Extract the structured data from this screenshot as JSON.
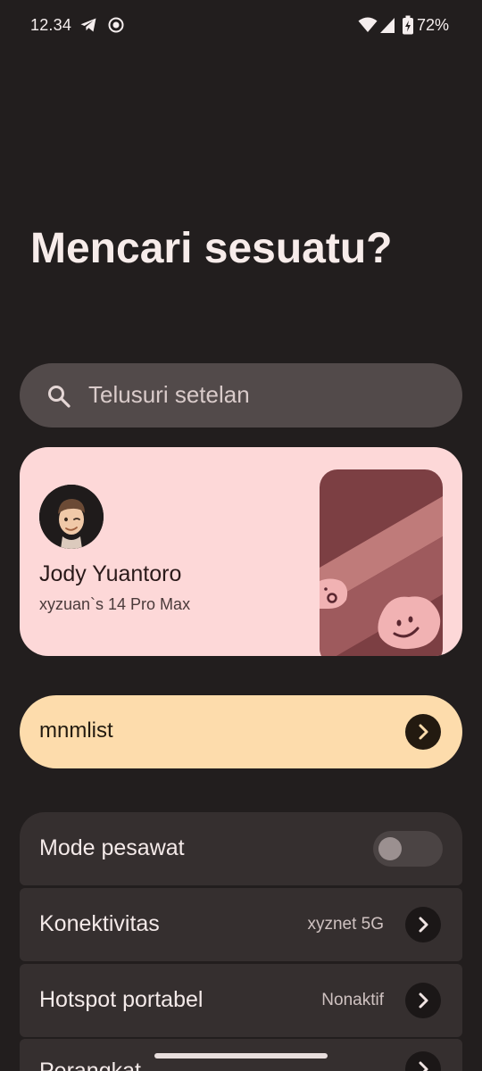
{
  "status_bar": {
    "time": "12.34",
    "battery_percent": "72%",
    "icons": [
      "telegram-icon",
      "screen-record-icon",
      "wifi-icon",
      "cellular-signal-icon",
      "battery-charging-icon"
    ]
  },
  "page": {
    "title": "Mencari sesuatu?"
  },
  "search": {
    "placeholder": "Telusuri setelan"
  },
  "profile": {
    "name": "Jody Yuantoro",
    "device": "xyzuan`s 14 Pro Max"
  },
  "account": {
    "label": "mnmlist"
  },
  "settings": [
    {
      "label": "Mode pesawat",
      "control": "toggle",
      "on": false
    },
    {
      "label": "Konektivitas",
      "value": "xyznet 5G",
      "control": "chevron"
    },
    {
      "label": "Hotspot portabel",
      "value": "Nonaktif",
      "control": "chevron"
    },
    {
      "label": "Perangkat",
      "control": "chevron"
    }
  ],
  "colors": {
    "background": "#221e1e",
    "search_bg": "#524a4a",
    "profile_card": "#fdd8d8",
    "account_pill": "#fddcac",
    "row_bg": "#352f2f"
  }
}
